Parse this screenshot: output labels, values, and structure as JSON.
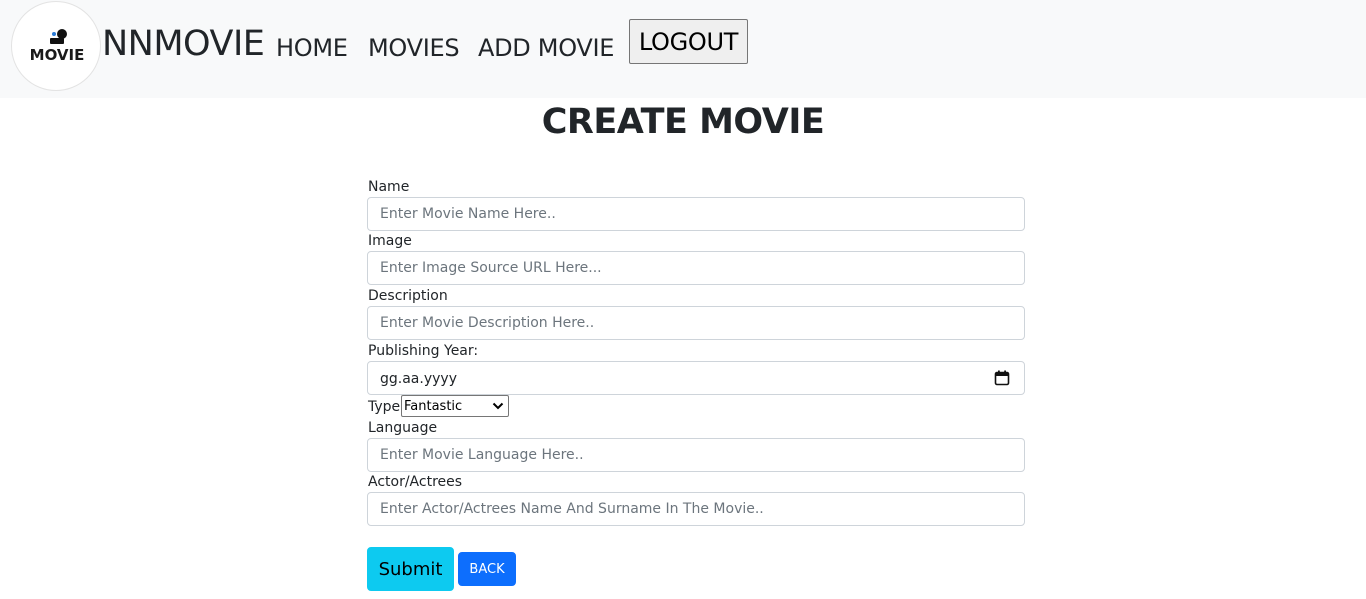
{
  "header": {
    "logo_text": "MOVIE",
    "brand": "NNMOVIE",
    "nav": {
      "home": "HOME",
      "movies": "MOVIES",
      "add_movie": "ADD MOVIE"
    },
    "logout_label": "LOGOUT"
  },
  "page": {
    "title": "CREATE MOVIE"
  },
  "form": {
    "name": {
      "label": "Name",
      "placeholder": "Enter Movie Name Here.."
    },
    "image": {
      "label": "Image",
      "placeholder": "Enter Image Source URL Here..."
    },
    "description": {
      "label": "Description",
      "placeholder": "Enter Movie Description Here.."
    },
    "publishing_year": {
      "label": "Publishing Year:",
      "value": "gg.aa.yyyy"
    },
    "type": {
      "label": "Type",
      "selected": "Fantastic"
    },
    "language": {
      "label": "Language",
      "placeholder": "Enter Movie Language Here.."
    },
    "actor": {
      "label": "Actor/Actrees",
      "placeholder": "Enter Actor/Actrees Name And Surname In The Movie.."
    },
    "submit_label": "Submit",
    "back_label": "BACK"
  },
  "colors": {
    "navbar_bg": "#f8f9fa",
    "submit_bg": "#0dcaf0",
    "back_bg": "#0d6efd"
  },
  "icons": [
    "movie-logo-icon",
    "calendar-icon",
    "chevron-down-icon"
  ]
}
